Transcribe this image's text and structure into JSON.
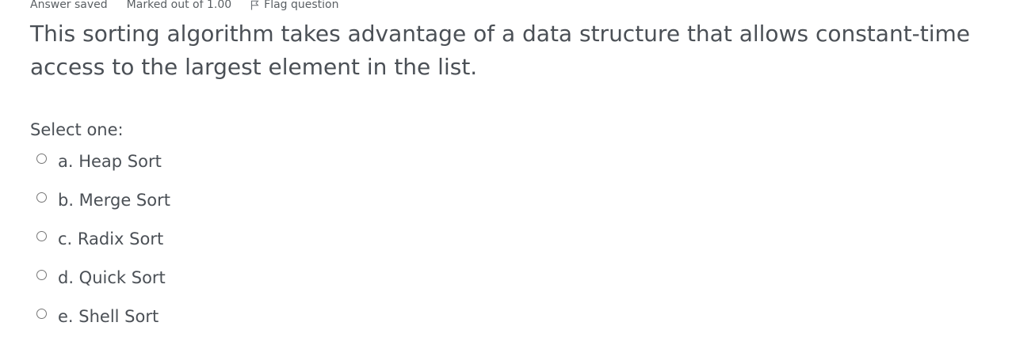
{
  "question_info": {
    "state": "Answer saved",
    "grade": "Marked out of 1.00",
    "flag_label": "Flag question",
    "flag_icon": "flag-icon"
  },
  "question": {
    "text": "This sorting algorithm takes advantage of a data structure that allows constant-time access to the largest element in the list."
  },
  "answer": {
    "prompt": "Select one:",
    "options": [
      {
        "label": "a. Heap Sort",
        "selected": false
      },
      {
        "label": "b. Merge Sort",
        "selected": false
      },
      {
        "label": "c. Radix Sort",
        "selected": false
      },
      {
        "label": "d. Quick Sort",
        "selected": false
      },
      {
        "label": "e. Shell Sort",
        "selected": false
      }
    ]
  }
}
